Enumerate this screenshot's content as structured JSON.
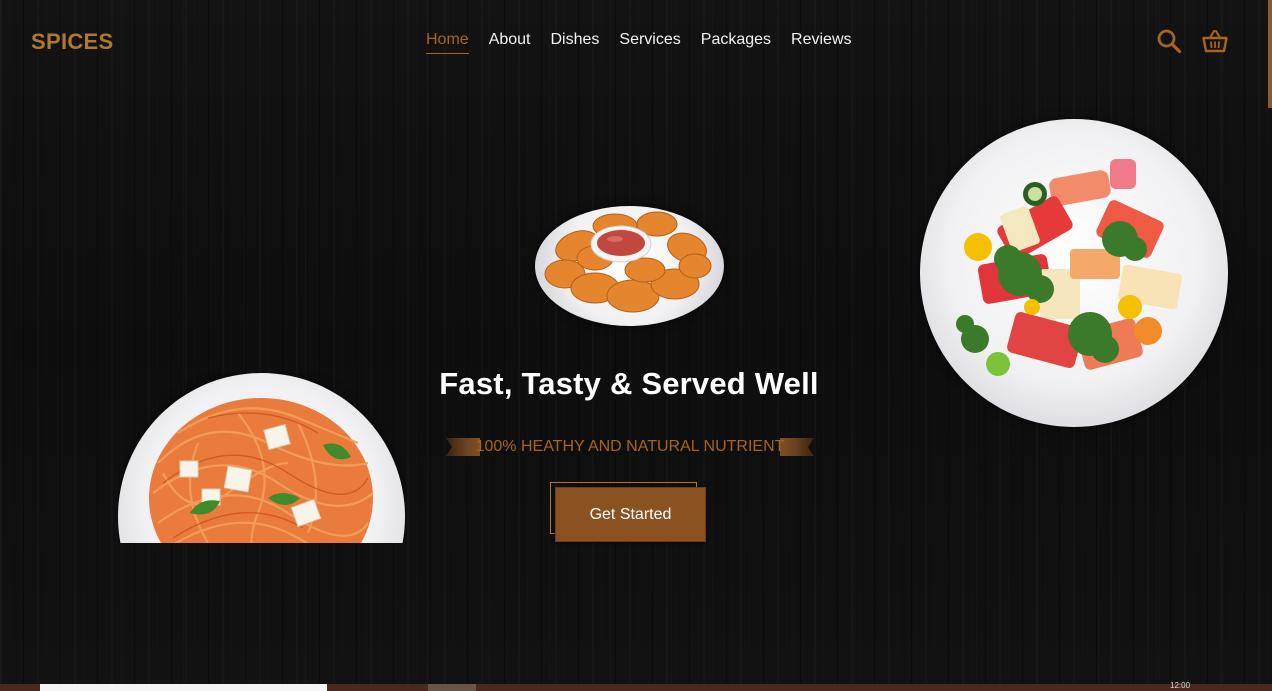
{
  "header": {
    "logo": "SPICES",
    "nav": [
      {
        "label": "Home",
        "active": true
      },
      {
        "label": "About",
        "active": false
      },
      {
        "label": "Dishes",
        "active": false
      },
      {
        "label": "Services",
        "active": false
      },
      {
        "label": "Packages",
        "active": false
      },
      {
        "label": "Reviews",
        "active": false
      }
    ],
    "icons": [
      "search-icon",
      "shopping-basket-icon"
    ]
  },
  "hero": {
    "title": "Fast, Tasty & Served Well",
    "tagline": "100% HEATHY AND NATURAL NUTRIENT",
    "cta_label": "Get Started",
    "images": [
      "chicken-nuggets-plate",
      "sashimi-plate",
      "spaghetti-plate"
    ]
  },
  "bottom": {
    "tiny_text": "12:00"
  },
  "colors": {
    "accent": "#a8631f",
    "logo": "#b0782f",
    "button": "#8a5220",
    "background": "#0f0f0f",
    "text": "#ffffff"
  }
}
